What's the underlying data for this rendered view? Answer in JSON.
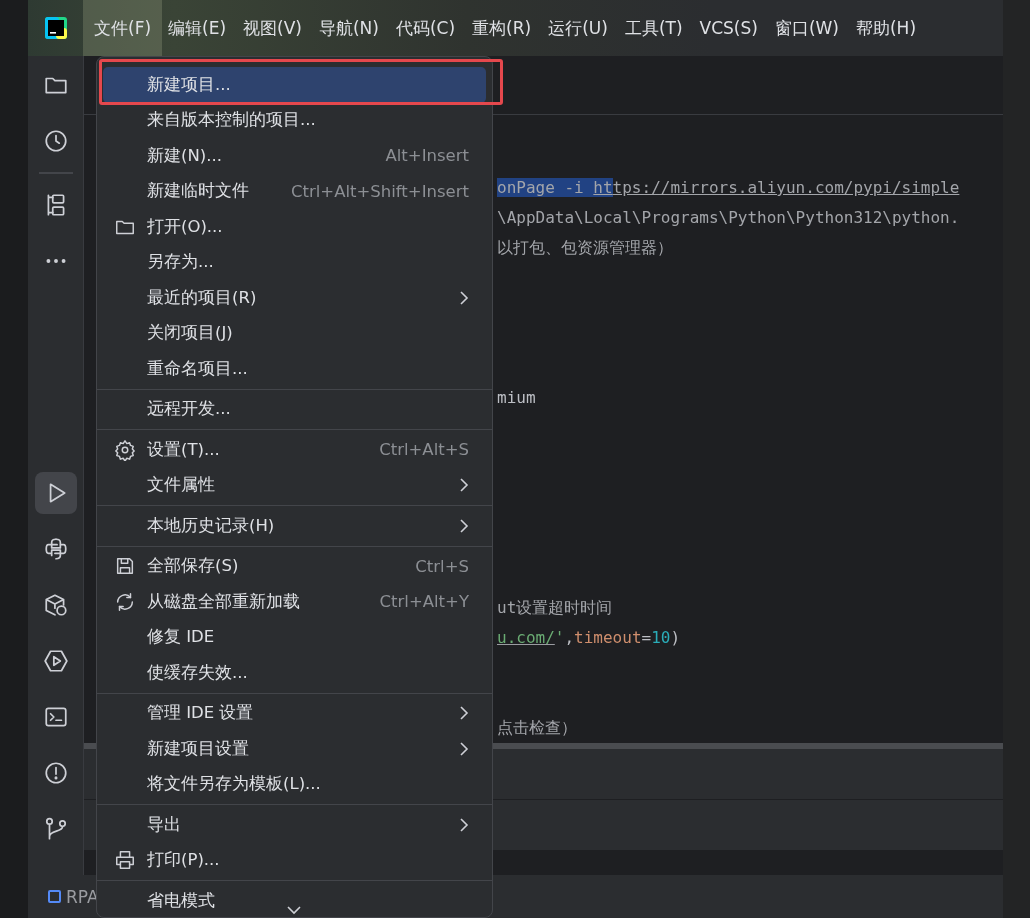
{
  "menu_bar": [
    {
      "label": "文件(F)",
      "selected": true
    },
    {
      "label": "编辑(E)",
      "selected": false
    },
    {
      "label": "视图(V)",
      "selected": false
    },
    {
      "label": "导航(N)",
      "selected": false
    },
    {
      "label": "代码(C)",
      "selected": false
    },
    {
      "label": "重构(R)",
      "selected": false
    },
    {
      "label": "运行(U)",
      "selected": false
    },
    {
      "label": "工具(T)",
      "selected": false
    },
    {
      "label": "VCS(S)",
      "selected": false
    },
    {
      "label": "窗口(W)",
      "selected": false
    },
    {
      "label": "帮助(H)",
      "selected": false
    }
  ],
  "tool_window_bar": [
    {
      "selected": false
    },
    {
      "selected": false
    },
    {
      "selected": false
    },
    {
      "selected": false
    },
    {
      "selected": true
    },
    {
      "selected": false
    },
    {
      "selected": false
    },
    {
      "selected": false
    },
    {
      "selected": false
    },
    {
      "selected": false
    },
    {
      "selected": false
    }
  ],
  "editor": {
    "lines": [
      {
        "segments": [
          {
            "text": "onPage -i ",
            "kind": "comment",
            "selected": true
          },
          {
            "text": "ht",
            "kind": "link",
            "selected": true
          },
          {
            "text": "tps://mirrors.aliyun.com/pypi/simple",
            "kind": "link",
            "selected": false
          }
        ]
      },
      {
        "segments": [
          {
            "text": "\\AppData\\Local\\Programs\\Python\\Python312\\python.",
            "kind": "comment",
            "selected": false
          }
        ]
      },
      {
        "segments": [
          {
            "text": "以打包、包资源管理器）",
            "kind": "comment",
            "selected": false
          }
        ]
      },
      {
        "segments": [
          {
            "text": "mium",
            "kind": "plain",
            "selected": false
          }
        ]
      },
      {
        "segments": [
          {
            "text": "ut设置超时时间",
            "kind": "comment",
            "selected": false
          }
        ]
      },
      {
        "segments": [
          {
            "text": "u.com/",
            "kind": "string-link",
            "selected": false
          },
          {
            "text": "'",
            "kind": "string",
            "selected": false
          },
          {
            "text": ",",
            "kind": "plain",
            "selected": false
          },
          {
            "text": "timeout",
            "kind": "param",
            "selected": false
          },
          {
            "text": "=",
            "kind": "plain",
            "selected": false
          },
          {
            "text": "10",
            "kind": "number",
            "selected": false
          },
          {
            "text": ")",
            "kind": "plain",
            "selected": false
          }
        ]
      },
      {
        "segments": [
          {
            "text": "点击检查）",
            "kind": "comment",
            "selected": false
          }
        ]
      }
    ]
  },
  "status_bar": {
    "project": "RPA"
  },
  "file_menu": {
    "more_below": true,
    "groups": [
      [
        {
          "label": "新建项目...",
          "selected": true,
          "highlighted": true,
          "submenu": false
        },
        {
          "label": "来自版本控制的项目...",
          "selected": false,
          "highlighted": false,
          "submenu": false
        },
        {
          "label": "新建(N)...",
          "shortcut": "Alt+Insert",
          "selected": false,
          "highlighted": false,
          "submenu": false
        },
        {
          "label": "新建临时文件",
          "shortcut": "Ctrl+Alt+Shift+Insert",
          "selected": false,
          "highlighted": false,
          "submenu": false
        },
        {
          "label": "打开(O)...",
          "selected": false,
          "highlighted": false,
          "submenu": false
        },
        {
          "label": "另存为...",
          "selected": false,
          "highlighted": false,
          "submenu": false
        },
        {
          "label": "最近的项目(R)",
          "selected": false,
          "highlighted": false,
          "submenu": true
        },
        {
          "label": "关闭项目(J)",
          "selected": false,
          "highlighted": false,
          "submenu": false
        },
        {
          "label": "重命名项目...",
          "selected": false,
          "highlighted": false,
          "submenu": false
        }
      ],
      [
        {
          "label": "远程开发...",
          "selected": false,
          "highlighted": false,
          "submenu": false
        }
      ],
      [
        {
          "label": "设置(T)...",
          "shortcut": "Ctrl+Alt+S",
          "selected": false,
          "highlighted": false,
          "submenu": false
        },
        {
          "label": "文件属性",
          "selected": false,
          "highlighted": false,
          "submenu": true
        }
      ],
      [
        {
          "label": "本地历史记录(H)",
          "selected": false,
          "highlighted": false,
          "submenu": true
        }
      ],
      [
        {
          "label": "全部保存(S)",
          "shortcut": "Ctrl+S",
          "selected": false,
          "highlighted": false,
          "submenu": false
        },
        {
          "label": "从磁盘全部重新加载",
          "shortcut": "Ctrl+Alt+Y",
          "selected": false,
          "highlighted": false,
          "submenu": false
        },
        {
          "label": "修复 IDE",
          "selected": false,
          "highlighted": false,
          "submenu": false
        },
        {
          "label": "使缓存失效...",
          "selected": false,
          "highlighted": false,
          "submenu": false
        }
      ],
      [
        {
          "label": "管理 IDE 设置",
          "selected": false,
          "highlighted": false,
          "submenu": true
        },
        {
          "label": "新建项目设置",
          "selected": false,
          "highlighted": false,
          "submenu": true
        },
        {
          "label": "将文件另存为模板(L)...",
          "selected": false,
          "highlighted": false,
          "submenu": false
        }
      ],
      [
        {
          "label": "导出",
          "selected": false,
          "submenu": true
        },
        {
          "label": "打印(P)...",
          "selected": false,
          "submenu": false
        }
      ],
      [
        {
          "label": "省电模式",
          "selected": false,
          "submenu": false
        }
      ]
    ]
  }
}
